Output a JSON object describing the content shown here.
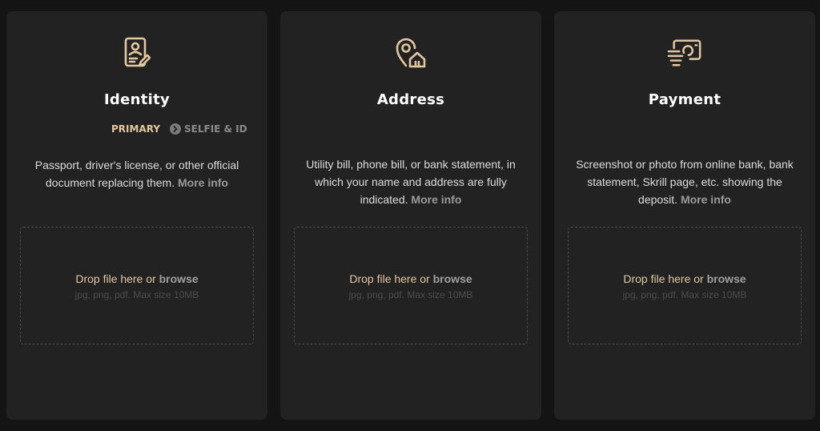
{
  "colors": {
    "background": "#141414",
    "card": "#222222",
    "accent": "#e2c79f",
    "muted": "#9a9a9a"
  },
  "cards": [
    {
      "title": "Identity",
      "icon": "id-card-icon",
      "tabs": {
        "primary": "PRIMARY",
        "secondary": "SELFIE & ID"
      },
      "description": "Passport, driver's license, or other official document replacing them.",
      "more_info": "More info",
      "drop_text": "Drop file here or",
      "browse": "browse",
      "hint": "jpg, png, pdf. Max size 10MB"
    },
    {
      "title": "Address",
      "icon": "location-home-icon",
      "description": "Utility bill, phone bill, or bank statement, in which your name and address are fully indicated.",
      "more_info": "More info",
      "drop_text": "Drop file here or",
      "browse": "browse",
      "hint": "jpg, png, pdf. Max size 10MB"
    },
    {
      "title": "Payment",
      "icon": "payment-card-icon",
      "description": "Screenshot or photo from online bank, bank statement, Skrill page, etc. showing the deposit.",
      "more_info": "More info",
      "drop_text": "Drop file here or",
      "browse": "browse",
      "hint": "jpg, png, pdf. Max size 10MB"
    }
  ]
}
